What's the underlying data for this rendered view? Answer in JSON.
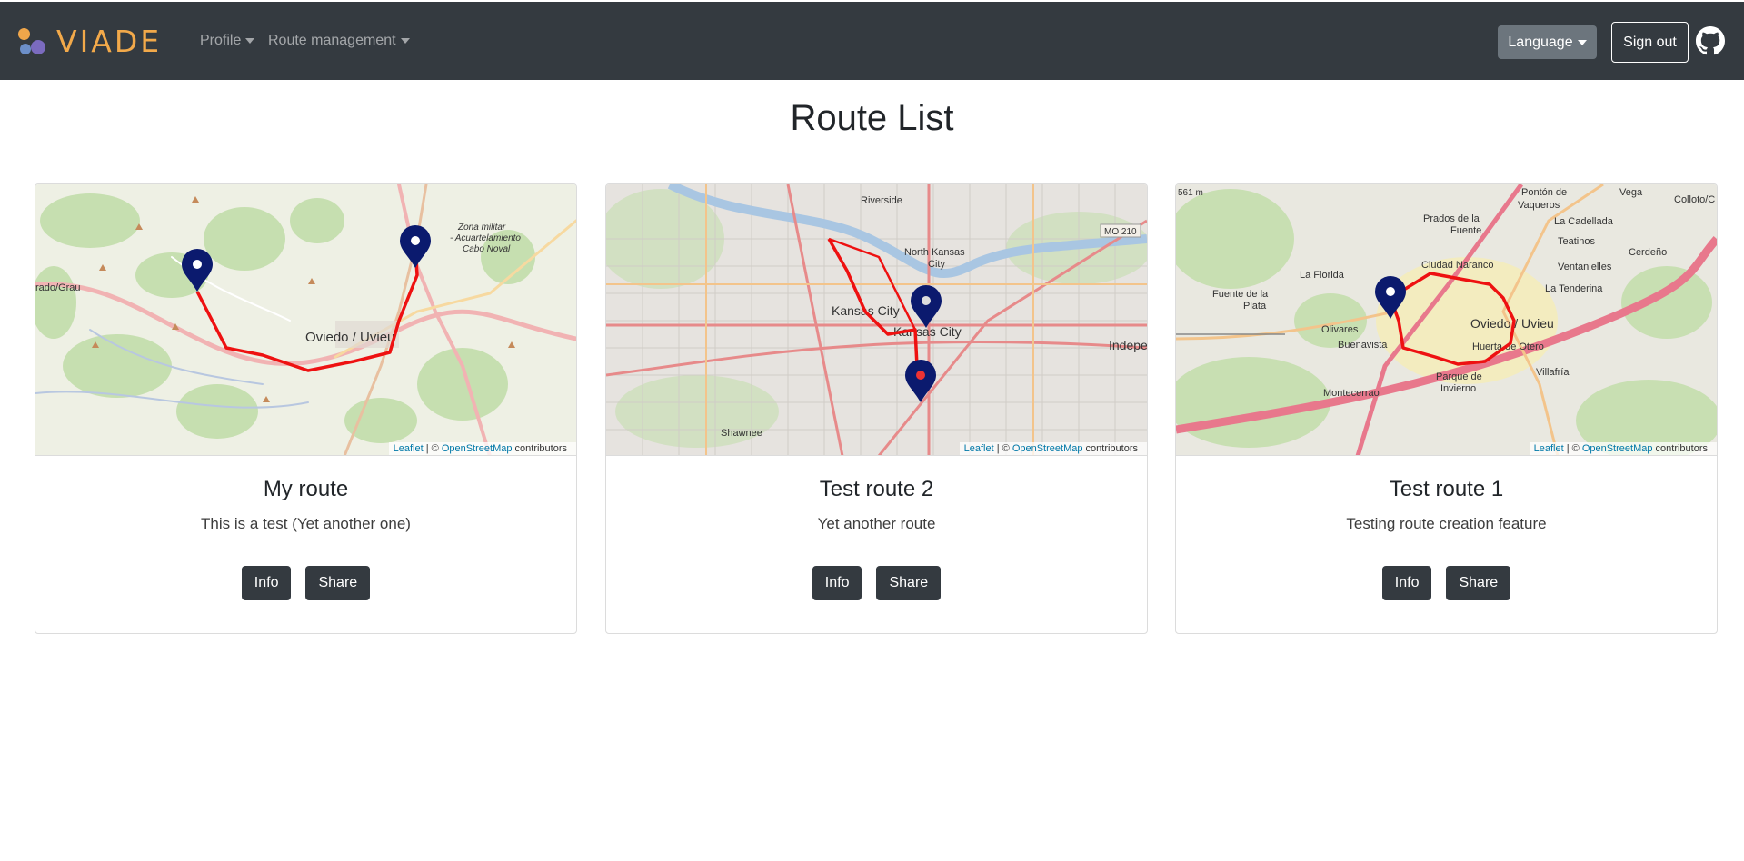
{
  "navbar": {
    "brand": "VIADE",
    "profile_label": "Profile",
    "route_management_label": "Route management",
    "language_label": "Language",
    "signout_label": "Sign out",
    "github_icon": "github-icon"
  },
  "page": {
    "title": "Route List"
  },
  "routes": [
    {
      "title": "My route",
      "description": "This is a test (Yet another one)",
      "info_label": "Info",
      "share_label": "Share",
      "map_labels": {
        "city": "Oviedo / Uvieu",
        "west": "rado/Grau",
        "military": "Zona militar",
        "military2": "- Acuartelamiento",
        "military3": "Cabo Noval"
      },
      "attribution": {
        "leaflet": "Leaflet",
        "sep": " | © ",
        "osm": "OpenStreetMap",
        "contrib": " contributors"
      }
    },
    {
      "title": "Test route 2",
      "description": "Yet another route",
      "info_label": "Info",
      "share_label": "Share",
      "map_labels": {
        "city": "Kansas City",
        "city2": "Kansas City",
        "north": "North Kansas",
        "north2": "City",
        "riverside": "Riverside",
        "shawnee": "Shawnee",
        "indep": "Indepe",
        "mo": "MO 210"
      },
      "attribution": {
        "leaflet": "Leaflet",
        "sep": " | © ",
        "osm": "OpenStreetMap",
        "contrib": " contributors"
      }
    },
    {
      "title": "Test route 1",
      "description": "Testing route creation feature",
      "info_label": "Info",
      "share_label": "Share",
      "map_labels": {
        "city": "Oviedo / Uvieu",
        "naranco": "Ciudad Naranco",
        "florida": "La Florida",
        "fuente": "Fuente de la",
        "fuente2": "Plata",
        "olivares": "Olivares",
        "buenavista": "Buenavista",
        "montecerrao": "Montecerrao",
        "parque": "Parque de",
        "parque2": "Invierno",
        "villafria": "Villafría",
        "huerta": "Huerta de Otero",
        "tenderina": "La Tenderina",
        "ventanielles": "Ventanielles",
        "teatinos": "Teatinos",
        "cadellada": "La Cadellada",
        "cerdeno": "Cerdeño",
        "prados": "Prados de la",
        "prados2": "Fuente",
        "ponton": "Pontón de",
        "ponton2": "Vaqueros",
        "vega": "Vega",
        "colloto": "Colloto/C",
        "alt": "561 m"
      },
      "attribution": {
        "leaflet": "Leaflet",
        "sep": " | © ",
        "osm": "OpenStreetMap",
        "contrib": " contributors"
      }
    }
  ],
  "colors": {
    "navbar": "#343a40",
    "brand": "#f2a94a",
    "route_line": "#ee1111",
    "marker": "#0b1a6e"
  }
}
